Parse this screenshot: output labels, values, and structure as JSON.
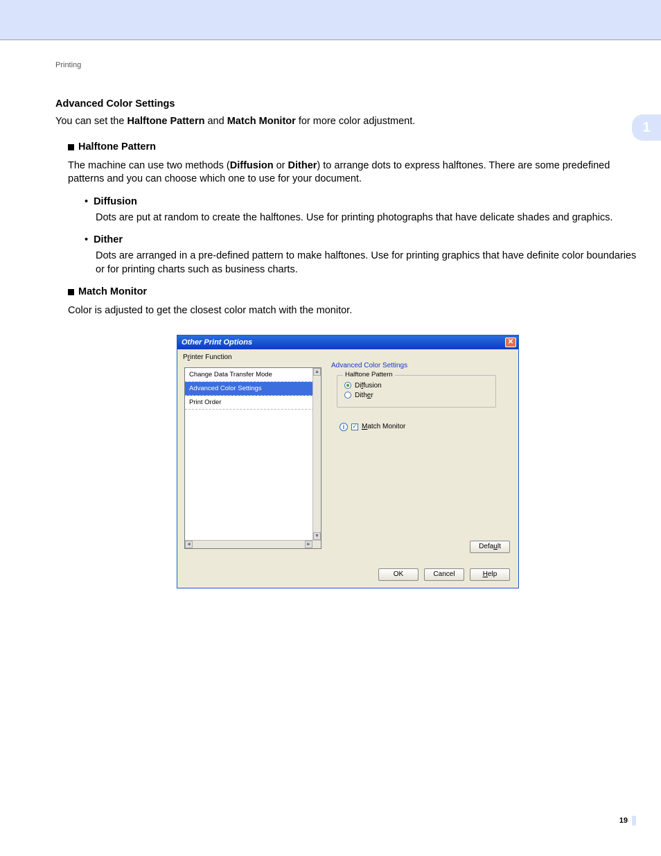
{
  "page": {
    "section_label": "Printing",
    "chapter_number": "1",
    "page_number": "19"
  },
  "doc": {
    "heading": "Advanced Color Settings",
    "intro_a": "You can set the ",
    "intro_b_bold": "Halftone Pattern",
    "intro_c": " and ",
    "intro_d_bold": "Match Monitor",
    "intro_e": " for more color adjustment.",
    "hp_label": "Halftone Pattern",
    "hp_body_a": "The machine can use two methods (",
    "hp_body_bold1": "Diffusion",
    "hp_body_mid": " or ",
    "hp_body_bold2": "Dither",
    "hp_body_b": ") to arrange dots to express halftones. There are some predefined patterns and you can choose which one to use for your document.",
    "diff_label": "Diffusion",
    "diff_body": "Dots are put at random to create the halftones. Use for printing photographs that have delicate shades and graphics.",
    "dither_label": "Dither",
    "dither_body": "Dots are arranged in a pre-defined pattern to make halftones. Use for printing graphics that have definite color boundaries or for printing charts such as business charts.",
    "mm_label": "Match Monitor",
    "mm_body": "Color is adjusted to get the closest color match with the monitor."
  },
  "dialog": {
    "title": "Other Print Options",
    "printer_function_label": "Printer Function",
    "printer_function_ul": "r",
    "list": {
      "items": [
        "Change Data Transfer Mode",
        "Advanced Color Settings",
        "Print Order"
      ],
      "selected_index": 1
    },
    "group_title": "Advanced Color Settings",
    "fieldset_label": "Halftone Pattern",
    "radio_diffusion": "Diffusion",
    "radio_diffusion_pre": "Di",
    "radio_diffusion_ul": "f",
    "radio_diffusion_post": "fusion",
    "radio_dither_pre": "Dith",
    "radio_dither_ul": "e",
    "radio_dither_post": "r",
    "radio_selected": "diffusion",
    "match_monitor_pre": "",
    "match_monitor_ul": "M",
    "match_monitor_post": "atch Monitor",
    "match_monitor_checked": true,
    "buttons": {
      "default_pre": "Defa",
      "default_ul": "u",
      "default_post": "lt",
      "ok": "OK",
      "cancel": "Cancel",
      "help_ul": "H",
      "help_post": "elp"
    }
  }
}
